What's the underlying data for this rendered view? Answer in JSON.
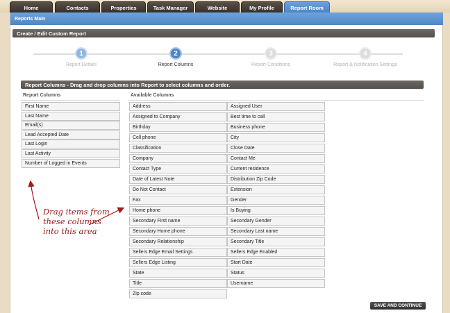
{
  "nav": {
    "tabs": [
      "Home",
      "Contacts",
      "Properties",
      "Task Manager",
      "Website",
      "My Profile",
      "Report Room"
    ],
    "active_tab": "Report Room"
  },
  "breadcrumb": "Reports Main",
  "page_title": "Create / Edit Custom Report",
  "wizard": {
    "steps": [
      {
        "number": "1",
        "label": "Report Details"
      },
      {
        "number": "2",
        "label": "Report Columns"
      },
      {
        "number": "3",
        "label": "Report Conditions"
      },
      {
        "number": "4",
        "label": "Report & Notification Settings"
      }
    ],
    "current_step": 2
  },
  "columns_section": {
    "title": "Report Columns - Drag and drop columns into Report to select columns and order.",
    "report_columns_heading": "Report Columns",
    "available_columns_heading": "Available Columns",
    "report_columns": [
      "First Name",
      "Last Name",
      "Email(s)",
      "Lead Accepted Date",
      "Last Login",
      "Last Activity",
      "Number of Logged in Events"
    ],
    "available_columns_left": [
      "Address",
      "Assigned to Company",
      "Birthday",
      "Cell phone",
      "Classification",
      "Company",
      "Contact Type",
      "Date of Latest Note",
      "Do Not Contact",
      "Fax",
      "Home phone",
      "Secondary First name",
      "Secondary Home phone",
      "Secondary Relationship",
      "Sellers Edge Email Settings",
      "Sellers Edge Listing",
      "State",
      "Title",
      "Zip code"
    ],
    "available_columns_right": [
      "Assigned User",
      "Best time to call",
      "Business phone",
      "City",
      "Close Date",
      "Contact Me",
      "Current residence",
      "Distribution Zip Code",
      "Extension",
      "Gender",
      "Is Buying",
      "Secondary Gender",
      "Secondary Last name",
      "Secondary Title",
      "Sellers Edge Enabled",
      "Start Date",
      "Status",
      "Username"
    ]
  },
  "save_button": "SAVE AND CONTINUE",
  "annotation": "Drag items from these columns into this area",
  "colors": {
    "active_tab": "#4a83c4",
    "tab": "#3f3731",
    "annotation": "#a11a1a",
    "step_active": "#4a84c4",
    "step_inactive": "#8fb7df",
    "step_upcoming": "#dcdcdc"
  }
}
